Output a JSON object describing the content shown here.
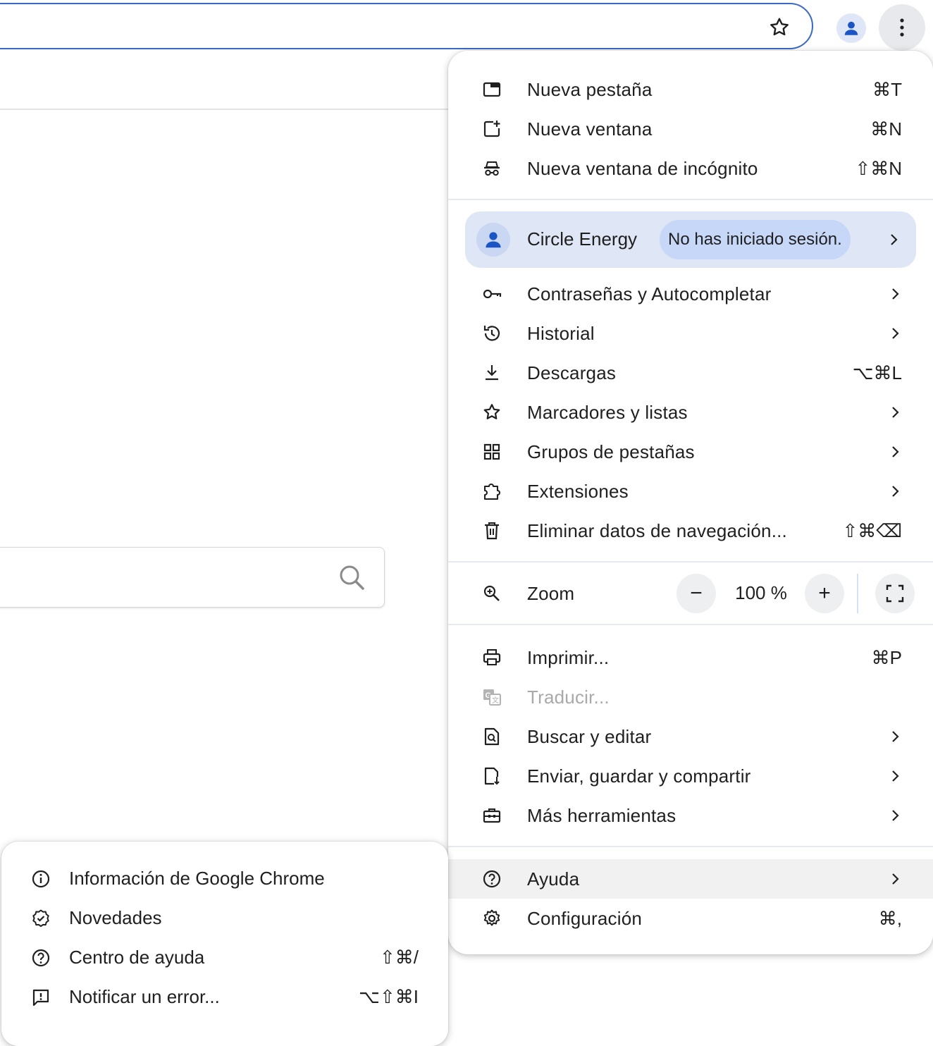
{
  "toolbar": {
    "bookmark_icon": "star-outline-icon",
    "profile_icon": "person-icon",
    "menu_icon": "three-dots-vertical-icon"
  },
  "menu": {
    "group1": [
      {
        "label": "Nueva pestaña",
        "shortcut": "⌘T",
        "icon": "new-tab-icon"
      },
      {
        "label": "Nueva ventana",
        "shortcut": "⌘N",
        "icon": "new-window-icon"
      },
      {
        "label": "Nueva ventana de incógnito",
        "shortcut": "⇧⌘N",
        "icon": "incognito-icon"
      }
    ],
    "profile": {
      "name": "Circle Energy",
      "status": "No has iniciado sesión."
    },
    "group2": [
      {
        "label": "Contraseñas y Autocompletar",
        "icon": "key-icon",
        "submenu": true
      },
      {
        "label": "Historial",
        "icon": "history-icon",
        "submenu": true
      },
      {
        "label": "Descargas",
        "shortcut": "⌥⌘L",
        "icon": "download-icon"
      },
      {
        "label": "Marcadores y listas",
        "icon": "star-icon",
        "submenu": true
      },
      {
        "label": "Grupos de pestañas",
        "icon": "tab-groups-icon",
        "submenu": true
      },
      {
        "label": "Extensiones",
        "icon": "extension-icon",
        "submenu": true
      },
      {
        "label": "Eliminar datos de navegación...",
        "shortcut": "⇧⌘⌫",
        "icon": "trash-icon"
      }
    ],
    "zoom": {
      "label": "Zoom",
      "value": "100 %",
      "minus": "−",
      "plus": "+"
    },
    "group3": [
      {
        "label": "Imprimir...",
        "shortcut": "⌘P",
        "icon": "print-icon"
      },
      {
        "label": "Traducir...",
        "icon": "translate-icon",
        "disabled": true
      },
      {
        "label": "Buscar y editar",
        "icon": "find-page-icon",
        "submenu": true
      },
      {
        "label": "Enviar, guardar y compartir",
        "icon": "save-share-icon",
        "submenu": true
      },
      {
        "label": "Más herramientas",
        "icon": "toolbox-icon",
        "submenu": true
      }
    ],
    "group4": [
      {
        "label": "Ayuda",
        "icon": "help-icon",
        "submenu": true,
        "highlighted": true
      },
      {
        "label": "Configuración",
        "shortcut": "⌘,",
        "icon": "settings-icon"
      }
    ]
  },
  "help_submenu": [
    {
      "label": "Información de Google Chrome",
      "icon": "info-icon"
    },
    {
      "label": "Novedades",
      "icon": "new-badge-icon"
    },
    {
      "label": "Centro de ayuda",
      "shortcut": "⇧⌘/",
      "icon": "help-icon"
    },
    {
      "label": "Notificar un error...",
      "shortcut": "⌥⇧⌘I",
      "icon": "feedback-icon"
    }
  ],
  "colors": {
    "accent": "#3a69c8",
    "profile_bg": "#dfe6f5",
    "chip_bg": "#c6d7f8",
    "avatar_blue": "#1b54c4"
  }
}
